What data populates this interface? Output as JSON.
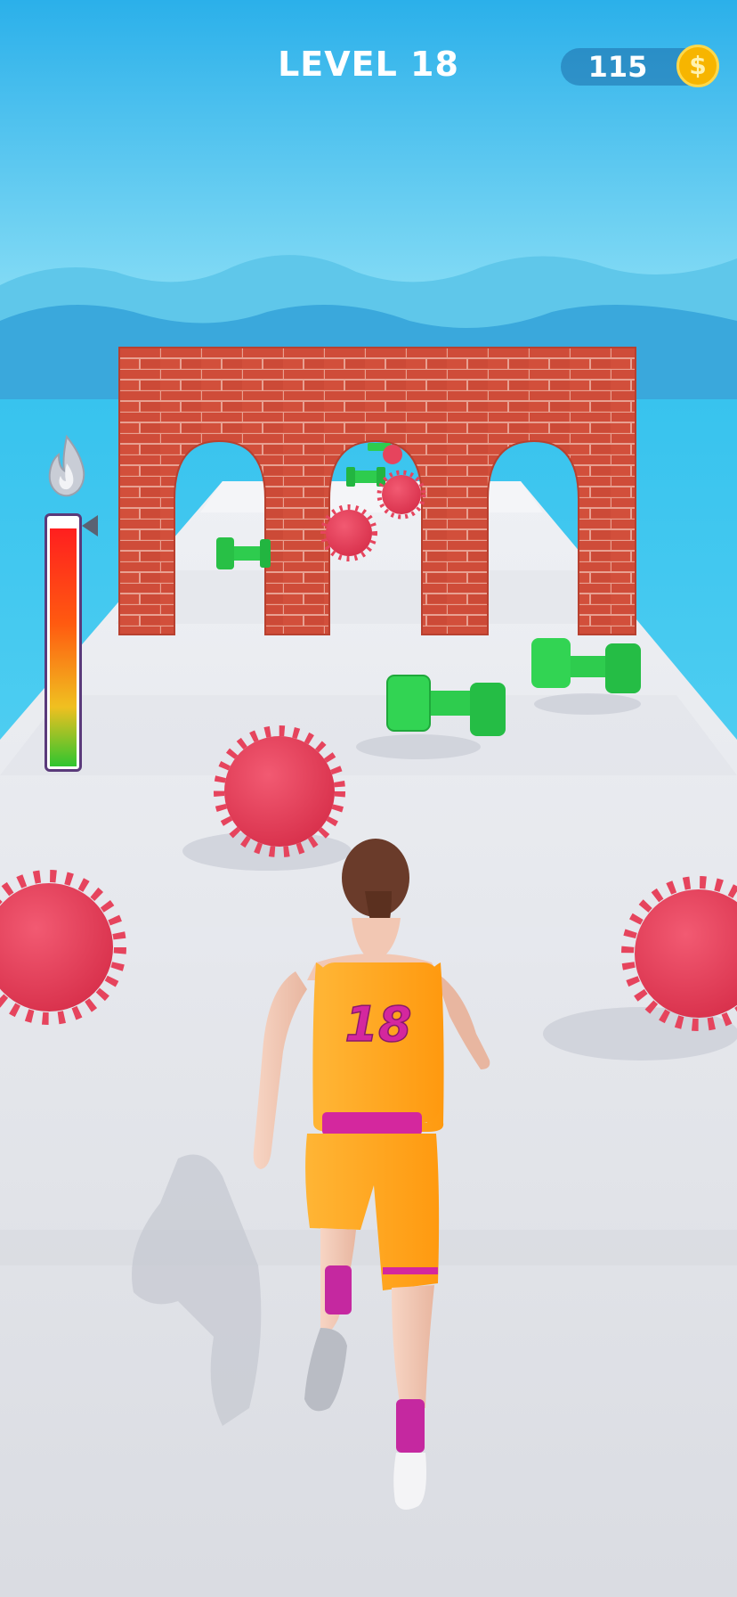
{
  "hud": {
    "level_label": "LEVEL 18",
    "coins": "115",
    "coin_symbol": "$"
  },
  "player": {
    "jersey_number": "18"
  },
  "energy_meter": {
    "level": 0.96
  },
  "icons": {
    "energy": "flame-icon",
    "coin": "coin-icon"
  },
  "colors": {
    "sky_top": "#2fb4ea",
    "sky_bottom": "#8fe4f7",
    "sea": "#3dc5ee",
    "track": "#e9eaee",
    "brick": "#d9533f",
    "obstacle": "#e6445d",
    "dumbbell": "#2ecc4e",
    "jersey": "#ffa51f",
    "accent": "#d4279e"
  }
}
